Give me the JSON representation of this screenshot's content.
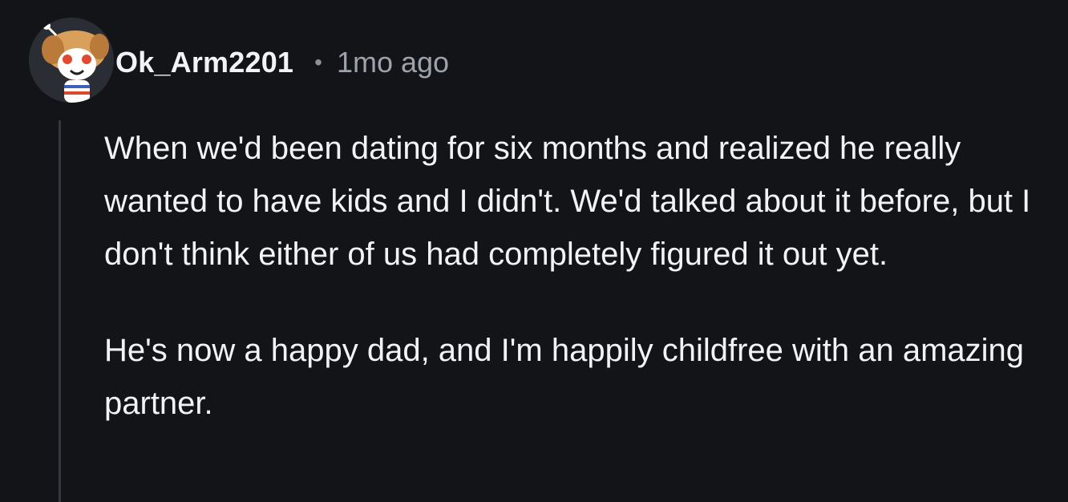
{
  "comment": {
    "author": "Ok_Arm2201",
    "separator": "•",
    "timestamp": "1mo ago",
    "avatar_icon": "snoo-dog-avatar-icon",
    "paragraphs": [
      "When we'd been dating for six months and realized he really wanted to have kids and I didn't. We'd talked about it before, but I don't think either of us had completely figured it out yet.",
      "He's now a happy dad, and I'm happily childfree with an amazing partner."
    ]
  },
  "colors": {
    "background": "#121418",
    "text": "#f2f3f5",
    "meta_text": "#9ea3ab",
    "thread_line": "#34373d"
  }
}
